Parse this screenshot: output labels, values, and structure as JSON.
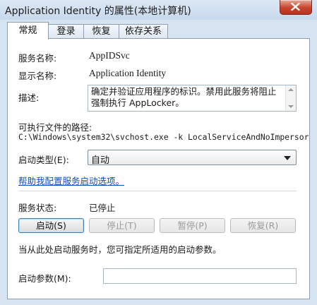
{
  "window": {
    "title": "Application Identity 的属性(本地计算机)"
  },
  "tabs": [
    {
      "label": "常规"
    },
    {
      "label": "登录"
    },
    {
      "label": "恢复"
    },
    {
      "label": "依存关系"
    }
  ],
  "general": {
    "service_name_label": "服务名称:",
    "service_name_value": "AppIDSvc",
    "display_name_label": "显示名称:",
    "display_name_value": "Application Identity",
    "description_label": "描述:",
    "description_value": "确定并验证应用程序的标识。禁用此服务将阻止强制执行 AppLocker。",
    "exe_path_label": "可执行文件的路径:",
    "exe_path_value": "C:\\Windows\\system32\\svchost.exe -k LocalServiceAndNoImpersor",
    "startup_type_label": "启动类型(E):",
    "startup_type_value": "自动",
    "help_link": "帮助我配置服务启动选项。",
    "service_status_label": "服务状态:",
    "service_status_value": "已停止",
    "start_button": "启动(S)",
    "stop_button": "停止(T)",
    "pause_button": "暂停(P)",
    "resume_button": "恢复(R)",
    "hint_text": "当从此处启动服务时，您可指定所适用的启动参数。",
    "start_params_label": "启动参数(M):",
    "start_params_value": ""
  },
  "colors": {
    "window_frame": "#d6e4f2",
    "link": "#0a4fbf",
    "close_button": "#c7432b"
  }
}
